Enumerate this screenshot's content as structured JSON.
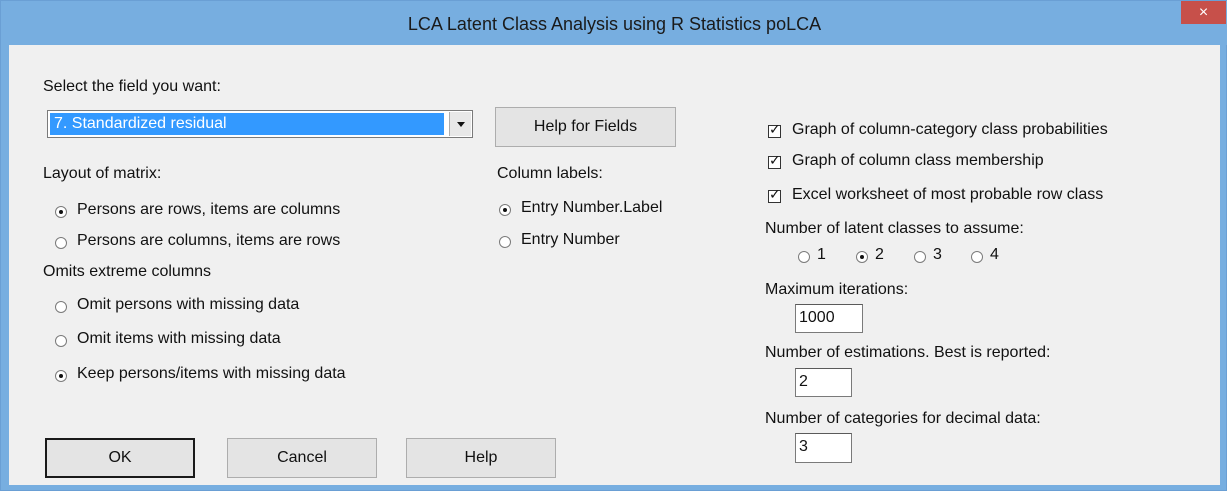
{
  "window": {
    "title": "LCA Latent Class Analysis using R Statistics poLCA",
    "close_label": "×"
  },
  "field": {
    "label": "Select the field you want:",
    "selected": "7. Standardized residual",
    "help_button": "Help for Fields"
  },
  "layout": {
    "label": "Layout of matrix:",
    "options": [
      "Persons are rows, items are columns",
      "Persons are columns, items are rows"
    ],
    "selected_index": 0
  },
  "omits": {
    "label": "Omits extreme columns",
    "options": [
      "Omit persons with missing data",
      "Omit items with missing data",
      "Keep persons/items with missing data"
    ],
    "selected_index": 2
  },
  "column_labels": {
    "label": "Column labels:",
    "options": [
      "Entry Number.Label",
      "Entry Number"
    ],
    "selected_index": 0
  },
  "checkboxes": [
    {
      "label": "Graph of column-category class probabilities",
      "checked": true
    },
    {
      "label": "Graph of column class membership",
      "checked": true
    },
    {
      "label": "Excel worksheet of most probable row class",
      "checked": true
    }
  ],
  "classes": {
    "label": "Number of latent classes to assume:",
    "options": [
      "1",
      "2",
      "3",
      "4"
    ],
    "selected_index": 1
  },
  "iterations": {
    "label": "Maximum iterations:",
    "value": "1000"
  },
  "estimations": {
    "label": "Number of estimations. Best is reported:",
    "value": "2"
  },
  "categories": {
    "label": "Number of categories for decimal data:",
    "value": "3"
  },
  "buttons": {
    "ok": "OK",
    "cancel": "Cancel",
    "help": "Help"
  }
}
